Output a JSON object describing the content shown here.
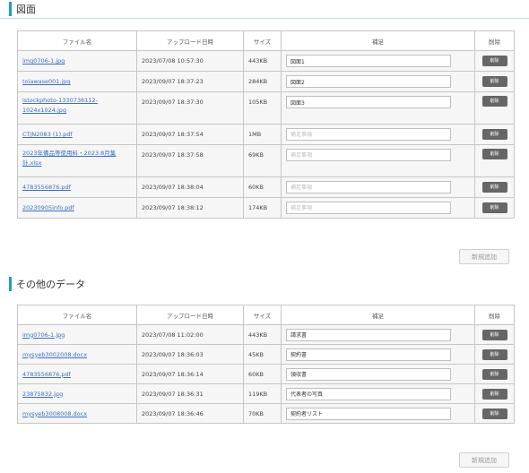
{
  "columns": {
    "file": "ファイル名",
    "uploaded": "アップロード日時",
    "size": "サイズ",
    "note": "補足",
    "delete": "削除"
  },
  "delete_label": "削除",
  "add_label": "新規追加",
  "note_placeholder": "補足事項",
  "sections": [
    {
      "title": "図面",
      "rows": [
        {
          "file": "img0706-1.jpg",
          "uploaded": "2023/07/08 10:57:30",
          "size": "443KB",
          "note": "図面1"
        },
        {
          "file": "toiawase001.jpg",
          "uploaded": "2023/09/07 18:37:23",
          "size": "284KB",
          "note": "図面2"
        },
        {
          "file": "istockphoto-1330736112-1024x1024.jpg",
          "uploaded": "2023/09/07 18:37:30",
          "size": "105KB",
          "note": "図面3"
        },
        {
          "file": "CTJN2083 (1).pdf",
          "uploaded": "2023/09/07 18:37:54",
          "size": "1MB",
          "note": ""
        },
        {
          "file": "2023年備品等使用料・2023.8月集計.xlsx",
          "uploaded": "2023/09/07 18:37:58",
          "size": "69KB",
          "note": ""
        },
        {
          "file": "4783556876.pdf",
          "uploaded": "2023/09/07 18:38:04",
          "size": "60KB",
          "note": ""
        },
        {
          "file": "20230905info.pdf",
          "uploaded": "2023/09/07 18:38:12",
          "size": "174KB",
          "note": ""
        }
      ]
    },
    {
      "title": "その他のデータ",
      "rows": [
        {
          "file": "img0706-1.jpg",
          "uploaded": "2023/07/08 11:02:00",
          "size": "443KB",
          "note": "請求書"
        },
        {
          "file": "mysyeb3002008.docx",
          "uploaded": "2023/09/07 18:36:03",
          "size": "45KB",
          "note": "契約書"
        },
        {
          "file": "4783556876.pdf",
          "uploaded": "2023/09/07 18:36:14",
          "size": "60KB",
          "note": "領収書"
        },
        {
          "file": "23875832.jpg",
          "uploaded": "2023/09/07 18:36:31",
          "size": "119KB",
          "note": "代表者の写真"
        },
        {
          "file": "mysyeb3008008.docx",
          "uploaded": "2023/09/07 18:36:46",
          "size": "70KB",
          "note": "契約者リスト"
        }
      ]
    }
  ]
}
